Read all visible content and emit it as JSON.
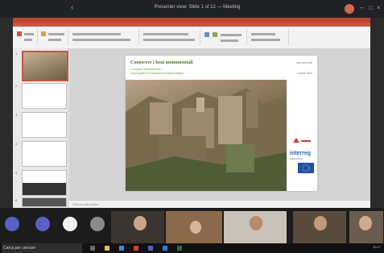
{
  "outer": {
    "title": "Presenter view: Slide 1 of 12 — Meeting",
    "back_icon": "chevron-left-icon"
  },
  "ppt": {
    "notes_placeholder": "Click to add notes",
    "slide": {
      "title": "Conoscere i beni monumentali",
      "subtitle_lines": [
        "Il recupero del patrimonio",
        "con progetti di cooperazione transfrontaliera"
      ],
      "right_lines": [
        "Ivan Antonelli",
        "7 aprile 2020"
      ],
      "logo_interreg": "interreg",
      "logo_sub": "Italia-Svizzera"
    },
    "thumbnails": [
      "1",
      "2",
      "3",
      "4",
      "5",
      "6"
    ]
  },
  "meeting": {
    "controls": [
      "mic-icon",
      "camera-icon",
      "share-icon",
      "more-icon"
    ],
    "participants": 6
  },
  "taskbar": {
    "search_placeholder": "Cerca per cercare",
    "clock": "10:17"
  }
}
